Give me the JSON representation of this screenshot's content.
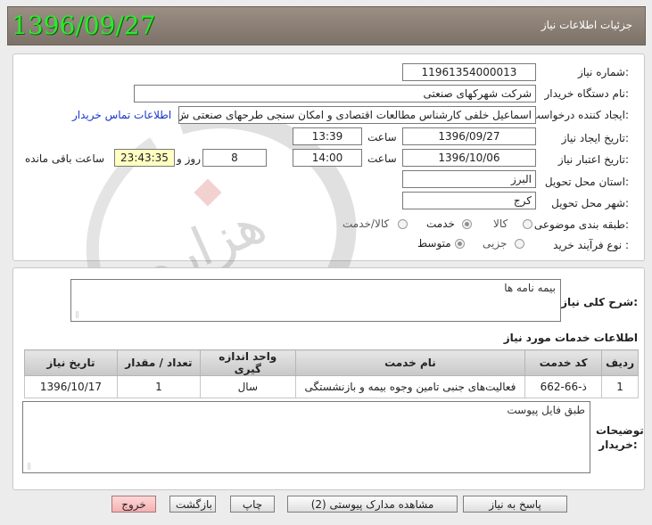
{
  "header": {
    "title": "جزئیات اطلاعات نیاز",
    "date_stamp": "1396/09/27"
  },
  "form": {
    "need_number": {
      "label": "شماره نیاز:",
      "value": "11961354000013"
    },
    "buyer_org": {
      "label": "نام دستگاه خریدار:",
      "value": "شرکت شهرکهای صنعتی"
    },
    "requester": {
      "label": "ایجاد کننده درخواست:",
      "value": "اسماعیل خلفی کارشناس مطالعات اقتصادی و امکان سنجی طرحهای صنعتی ش",
      "contact_link": "اطلاعات تماس خریدار"
    },
    "created": {
      "label": "تاریخ ایجاد نیاز:",
      "date": "1396/09/27",
      "time_label": "ساعت",
      "time": "13:39"
    },
    "validity": {
      "label": "تاریخ اعتبار نیاز:",
      "date": "1396/10/06",
      "time_label": "ساعت",
      "time": "14:00",
      "days": "8",
      "days_label": "روز و",
      "remaining": "23:43:35",
      "remaining_label": "ساعت باقی مانده"
    },
    "province": {
      "label": "استان محل تحویل:",
      "value": "البرز"
    },
    "city": {
      "label": "شهر محل تحویل:",
      "value": "کرج"
    },
    "category": {
      "label": "طبقه بندی موضوعی:",
      "options": [
        "کالا",
        "خدمت",
        "کالا/خدمت"
      ],
      "selected": "خدمت"
    },
    "process": {
      "label": "نوع فرآیند خرید :",
      "options": [
        "جزیی",
        "متوسط"
      ],
      "selected": "متوسط"
    }
  },
  "description": {
    "label": "شرح کلی نیاز:",
    "value": "بیمه نامه ها"
  },
  "services": {
    "title": "اطلاعات خدمات مورد نیاز",
    "columns": [
      "ردیف",
      "کد خدمت",
      "نام خدمت",
      "واحد اندازه گیری",
      "تعداد / مقدار",
      "تاریخ نیاز"
    ],
    "rows": [
      {
        "row": "1",
        "code": "ذ-66-662",
        "name": "فعالیت‌های جنبی تامین وجوه بیمه و بازنشستگی",
        "unit": "سال",
        "qty": "1",
        "date": "1396/10/17"
      }
    ]
  },
  "buyer_notes": {
    "label": "توضیحات خریدار:",
    "value": "طبق فایل پیوست"
  },
  "buttons": {
    "reply": "پاسخ به نیاز",
    "attachments": "مشاهده مدارک پیوستی (2)",
    "print": "چاپ",
    "back": "بازگشت",
    "exit": "خروج"
  },
  "watermark_text": "هزاره گستران"
}
